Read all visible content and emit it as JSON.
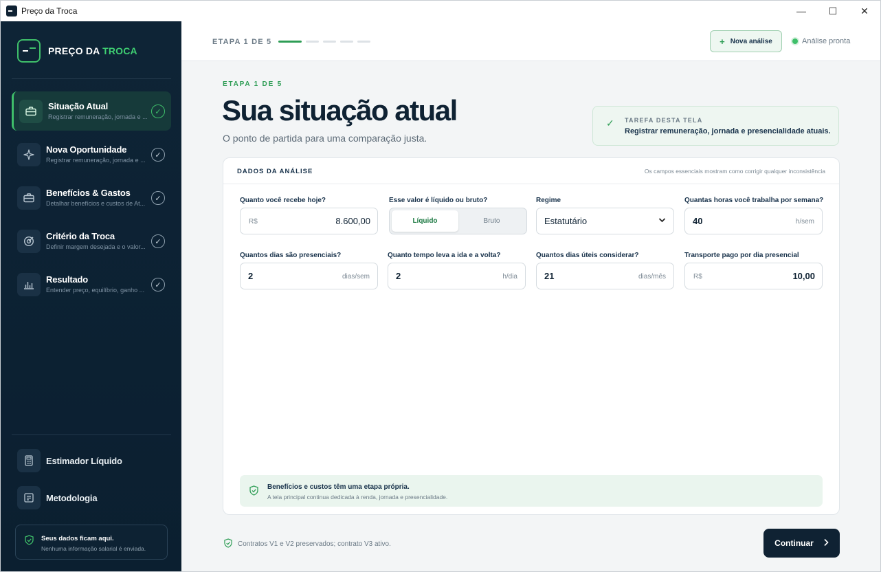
{
  "window": {
    "title": "Preço da Troca",
    "minimize": "—",
    "maximize": "☐",
    "close": "✕"
  },
  "brand": {
    "name_part1": "PREÇO DA ",
    "name_part2": "TROCA",
    "accent_color": "#3fcf72"
  },
  "sidebar": {
    "items": [
      {
        "label": "Situação Atual",
        "sub": "Registrar remuneração, jornada e ...",
        "icon": "briefcase-icon",
        "active": true
      },
      {
        "label": "Nova Oportunidade",
        "sub": "Registrar remuneração, jornada e ...",
        "icon": "sparkle-icon",
        "active": false
      },
      {
        "label": "Benefícios & Gastos",
        "sub": "Detalhar benefícios e custos de At...",
        "icon": "briefcase-icon",
        "active": false
      },
      {
        "label": "Critério da Troca",
        "sub": "Definir margem desejada e o valor...",
        "icon": "target-icon",
        "active": false
      },
      {
        "label": "Resultado",
        "sub": "Entender preço, equilíbrio, ganho ...",
        "icon": "bar-chart-icon",
        "active": false
      }
    ],
    "utilities": [
      {
        "label": "Estimador Líquido",
        "icon": "calculator-icon"
      },
      {
        "label": "Metodologia",
        "icon": "document-icon"
      }
    ],
    "privacy": {
      "title": "Seus dados ficam aqui.",
      "subtitle": "Nenhuma informação salarial é enviada."
    }
  },
  "topbar": {
    "step_indicator": "ETAPA 1 DE 5",
    "progress": {
      "current": 1,
      "total": 5
    },
    "new_button": "Nova análise",
    "new_button_icon": "+",
    "status": "Análise pronta"
  },
  "page": {
    "eyebrow": "ETAPA 1 DE 5",
    "title": "Sua situação atual",
    "subtitle": "O ponto de partida para uma comparação justa.",
    "task": {
      "label": "TAREFA DESTA TELA",
      "text": "Registrar remuneração, jornada e presencialidade atuais."
    }
  },
  "card": {
    "title": "DADOS DA ANÁLISE",
    "hint": "Os campos essenciais mostram como corrigir qualquer inconsistência",
    "fields": {
      "salary": {
        "label": "Quanto você recebe hoje?",
        "prefix": "R$",
        "value": "8.600,00"
      },
      "net_gross": {
        "label": "Esse valor é líquido ou bruto?",
        "options": [
          "Líquido",
          "Bruto"
        ],
        "selected": "Líquido"
      },
      "regime": {
        "label": "Regime",
        "value": "Estatutário"
      },
      "hours": {
        "label": "Quantas horas você trabalha por semana?",
        "value": "40",
        "unit": "h/sem"
      },
      "office_days": {
        "label": "Quantos dias são presenciais?",
        "value": "2",
        "unit": "dias/sem"
      },
      "commute": {
        "label": "Quanto tempo leva a ida e a volta?",
        "value": "2",
        "unit": "h/dia"
      },
      "work_days": {
        "label": "Quantos dias úteis considerar?",
        "value": "21",
        "unit": "dias/mês"
      },
      "transport": {
        "label": "Transporte pago por dia presencial",
        "prefix": "R$",
        "value": "10,00"
      }
    },
    "note": {
      "title": "Benefícios e custos têm uma etapa própria.",
      "subtitle": "A tela principal continua dedicada à renda, jornada e presencialidade."
    }
  },
  "footer": {
    "note": "Contratos V1 e V2 preservados; contrato V3 ativo.",
    "continue": "Continuar"
  }
}
